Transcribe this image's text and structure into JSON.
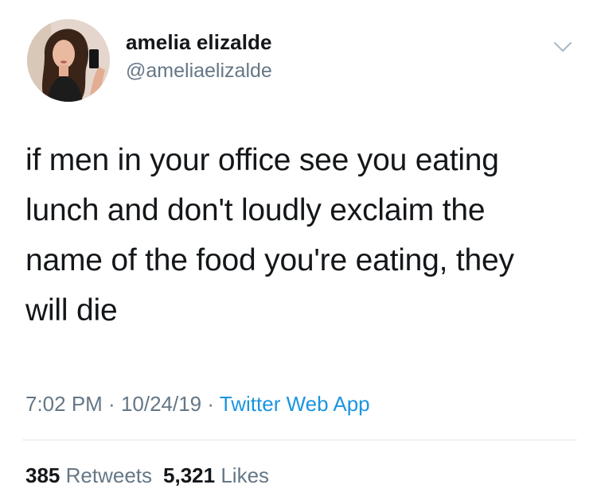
{
  "user": {
    "display_name": "amelia elizalde",
    "handle": "@ameliaelizalde"
  },
  "tweet": {
    "text": "if men in your office see you eating\nlunch and don't loudly exclaim the\nname of the food you're eating, they\nwill die"
  },
  "meta": {
    "time": "7:02 PM",
    "separator1": " · ",
    "date": "10/24/19",
    "separator2": " · ",
    "source": "Twitter Web App"
  },
  "stats": {
    "retweets_count": "385",
    "retweets_label": "Retweets",
    "likes_count": "5,321",
    "likes_label": "Likes"
  },
  "icons": {
    "menu": "chevron-down-icon"
  },
  "colors": {
    "text": "#14171a",
    "secondary": "#657786",
    "link": "#1b95e0",
    "divider": "#e1e8ed"
  }
}
